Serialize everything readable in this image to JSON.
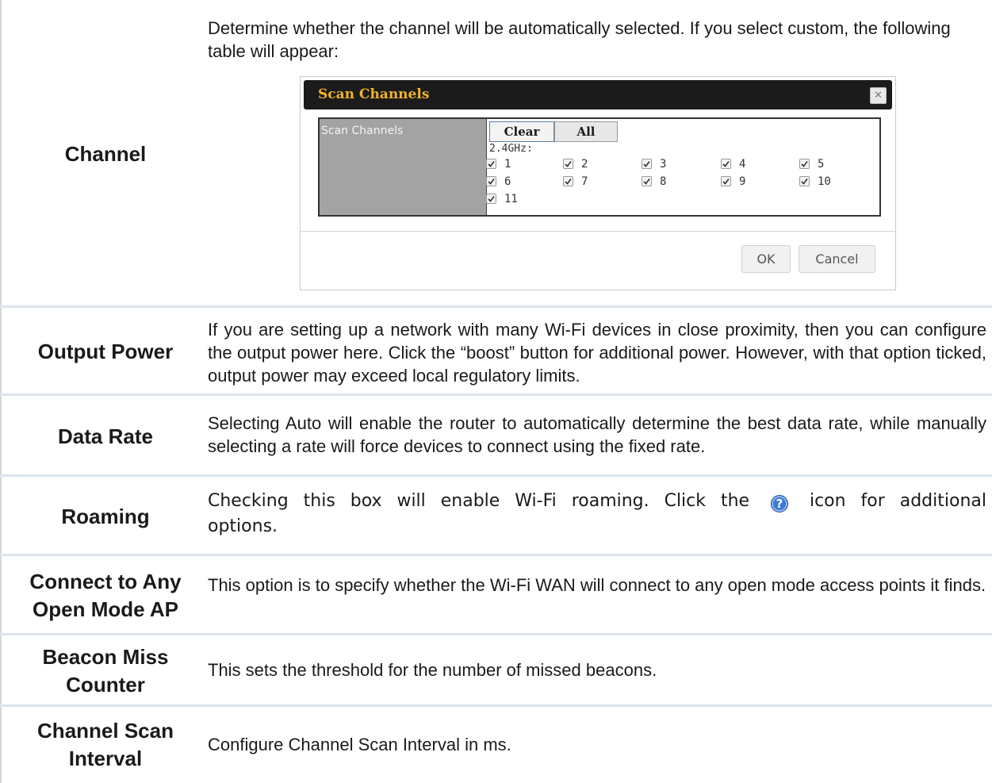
{
  "rows": [
    {
      "label": "Channel",
      "description": "Determine whether the channel will be automatically selected. If you select custom, the following table will appear:"
    },
    {
      "label": "Output Power",
      "description": "If you are setting up a network with many Wi-Fi devices in close proximity, then you can configure the output power here. Click the “boost” button for additional power. However, with that option ticked, output power may exceed local regulatory limits."
    },
    {
      "label": "Data Rate",
      "description": "Selecting Auto will enable the router to automatically determine the best data rate, while manually selecting a rate will force devices to connect using the fixed rate."
    },
    {
      "label": "Roaming",
      "description_before": "Checking this box will enable Wi-Fi roaming. Click the",
      "description_after": "icon for additional options.",
      "icon": "help-question-icon"
    },
    {
      "label_line1": "Connect to Any",
      "label_line2": "Open Mode AP",
      "description": "This option is to specify whether the Wi-Fi WAN will connect to any open mode access points it finds."
    },
    {
      "label_line1": "Beacon Miss",
      "label_line2": "Counter",
      "description": "This sets the threshold for the number of missed beacons."
    },
    {
      "label_line1": "Channel Scan",
      "label_line2": "Interval",
      "description": "Configure Channel Scan Interval in ms."
    }
  ],
  "dialog": {
    "title": "Scan Channels",
    "close_icon": "close-icon",
    "field_label": "Scan Channels",
    "clear_label": "Clear",
    "all_label": "All",
    "band_label": "2.4GHz:",
    "channels": [
      "1",
      "2",
      "3",
      "4",
      "5",
      "6",
      "7",
      "8",
      "9",
      "10",
      "11"
    ],
    "channels_checked": true,
    "ok_label": "OK",
    "cancel_label": "Cancel"
  },
  "colors": {
    "dialog_title": "#f0b323",
    "dialog_header_bg": "#1b1b1b",
    "row_rule": "#dde4ee",
    "help_icon": "#3d7bd1"
  }
}
